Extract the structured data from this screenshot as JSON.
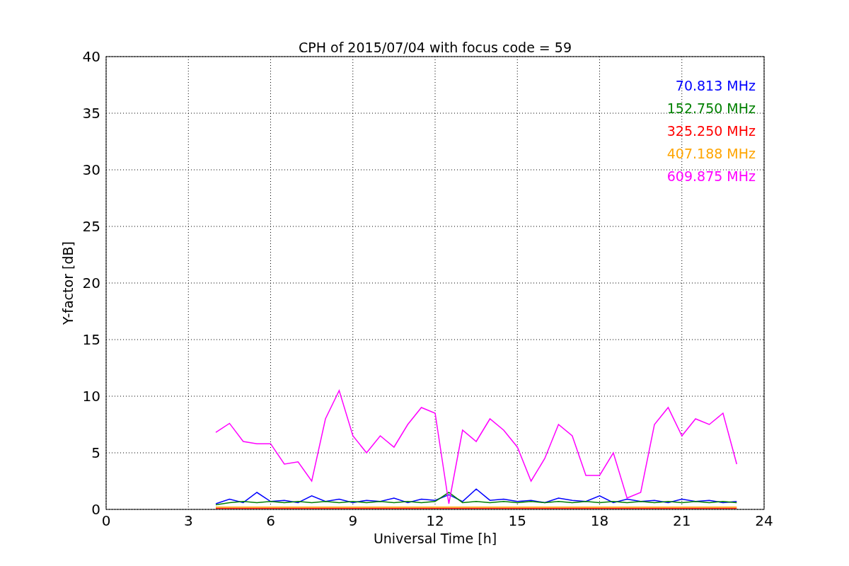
{
  "chart_data": {
    "type": "line",
    "title": "CPH of 2015/07/04 with focus code = 59",
    "xlabel": "Universal Time [h]",
    "ylabel": "Y-factor [dB]",
    "x": [
      4,
      4.5,
      5,
      5.5,
      6,
      6.5,
      7,
      7.5,
      8,
      8.5,
      9,
      9.5,
      10,
      10.5,
      11,
      11.5,
      12,
      12.5,
      13,
      13.5,
      14,
      14.5,
      15,
      15.5,
      16,
      16.5,
      17,
      17.5,
      18,
      18.5,
      19,
      19.5,
      20,
      20.5,
      21,
      21.5,
      22,
      22.5,
      23
    ],
    "series": [
      {
        "name": "70.813 MHz",
        "color": "#0000ff",
        "values": [
          0.5,
          0.9,
          0.6,
          1.5,
          0.7,
          0.8,
          0.6,
          1.2,
          0.7,
          0.9,
          0.6,
          0.8,
          0.7,
          1.0,
          0.6,
          0.9,
          0.8,
          1.3,
          0.7,
          1.8,
          0.8,
          0.9,
          0.7,
          0.8,
          0.6,
          1.0,
          0.8,
          0.7,
          1.2,
          0.6,
          0.9,
          0.7,
          0.8,
          0.6,
          0.9,
          0.7,
          0.8,
          0.6,
          0.7
        ]
      },
      {
        "name": "152.750 MHz",
        "color": "#008000",
        "values": [
          0.4,
          0.6,
          0.7,
          0.6,
          0.7,
          0.6,
          0.7,
          0.6,
          0.7,
          0.6,
          0.7,
          0.6,
          0.7,
          0.6,
          0.7,
          0.6,
          0.7,
          1.5,
          0.6,
          0.7,
          0.6,
          0.7,
          0.6,
          0.7,
          0.6,
          0.7,
          0.6,
          0.7,
          0.6,
          0.7,
          0.6,
          0.7,
          0.6,
          0.7,
          0.6,
          0.7,
          0.6,
          0.7,
          0.6
        ]
      },
      {
        "name": "325.250 MHz",
        "color": "#ff0000",
        "values": [
          0.1,
          0.1,
          0.1,
          0.1,
          0.1,
          0.1,
          0.1,
          0.1,
          0.1,
          0.1,
          0.1,
          0.1,
          0.1,
          0.1,
          0.1,
          0.1,
          0.1,
          0.1,
          0.1,
          0.1,
          0.1,
          0.1,
          0.1,
          0.1,
          0.1,
          0.1,
          0.1,
          0.1,
          0.1,
          0.1,
          0.1,
          0.1,
          0.1,
          0.1,
          0.1,
          0.1,
          0.1,
          0.1,
          0.1
        ]
      },
      {
        "name": "407.188 MHz",
        "color": "#ffa500",
        "values": [
          0.2,
          0.2,
          0.2,
          0.2,
          0.2,
          0.2,
          0.2,
          0.2,
          0.2,
          0.2,
          0.2,
          0.2,
          0.2,
          0.2,
          0.2,
          0.2,
          0.2,
          0.2,
          0.2,
          0.2,
          0.2,
          0.2,
          0.2,
          0.2,
          0.2,
          0.2,
          0.2,
          0.2,
          0.2,
          0.2,
          0.2,
          0.2,
          0.2,
          0.2,
          0.2,
          0.2,
          0.2,
          0.2,
          0.2
        ]
      },
      {
        "name": "609.875 MHz",
        "color": "#ff00ff",
        "values": [
          6.8,
          7.6,
          6.0,
          5.8,
          5.8,
          4.0,
          4.2,
          2.5,
          8.0,
          10.5,
          6.5,
          5.0,
          6.5,
          5.5,
          7.5,
          9.0,
          8.5,
          0.5,
          7.0,
          6.0,
          8.0,
          7.0,
          5.5,
          2.5,
          4.5,
          7.5,
          6.5,
          3.0,
          3.0,
          5.0,
          1.0,
          1.5,
          7.5,
          9.0,
          6.5,
          8.0,
          7.5,
          8.5,
          4.0
        ]
      }
    ],
    "grid": true,
    "xlim": [
      0,
      24
    ],
    "ylim": [
      0,
      40
    ],
    "xticks": [
      0,
      3,
      6,
      9,
      12,
      15,
      18,
      21,
      24
    ],
    "yticks": [
      0,
      5,
      10,
      15,
      20,
      25,
      30,
      35,
      40
    ]
  }
}
